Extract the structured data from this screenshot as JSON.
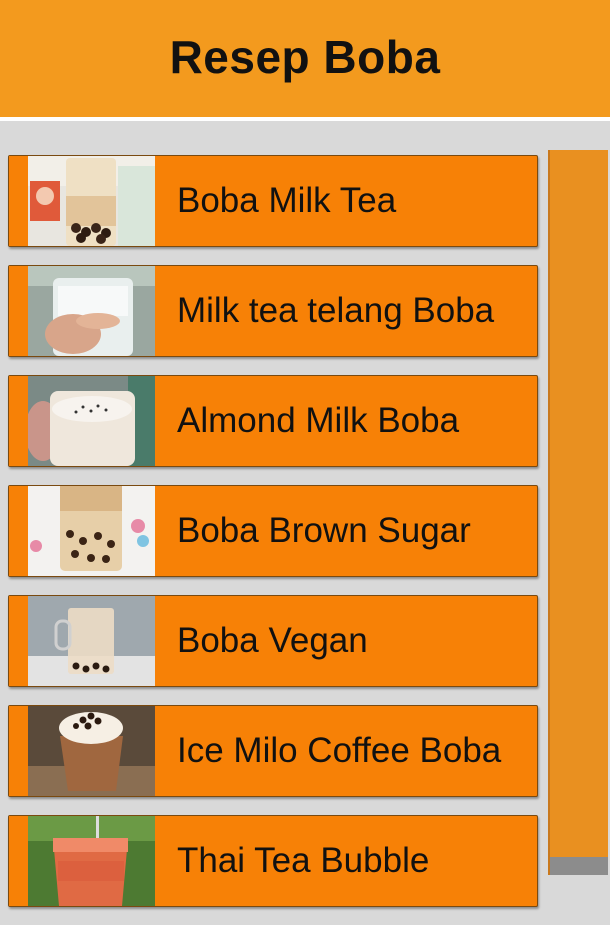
{
  "app": {
    "title": "Resep Boba"
  },
  "colors": {
    "header": "#f39a1e",
    "item": "#f78106",
    "background": "#d9d9d9"
  },
  "recipes": [
    {
      "label": "Boba Milk Tea"
    },
    {
      "label": "Milk tea telang Boba"
    },
    {
      "label": "Almond Milk Boba"
    },
    {
      "label": "Boba Brown Sugar"
    },
    {
      "label": "Boba Vegan"
    },
    {
      "label": "Ice Milo Coffee Boba"
    },
    {
      "label": "Thai Tea Bubble"
    }
  ]
}
